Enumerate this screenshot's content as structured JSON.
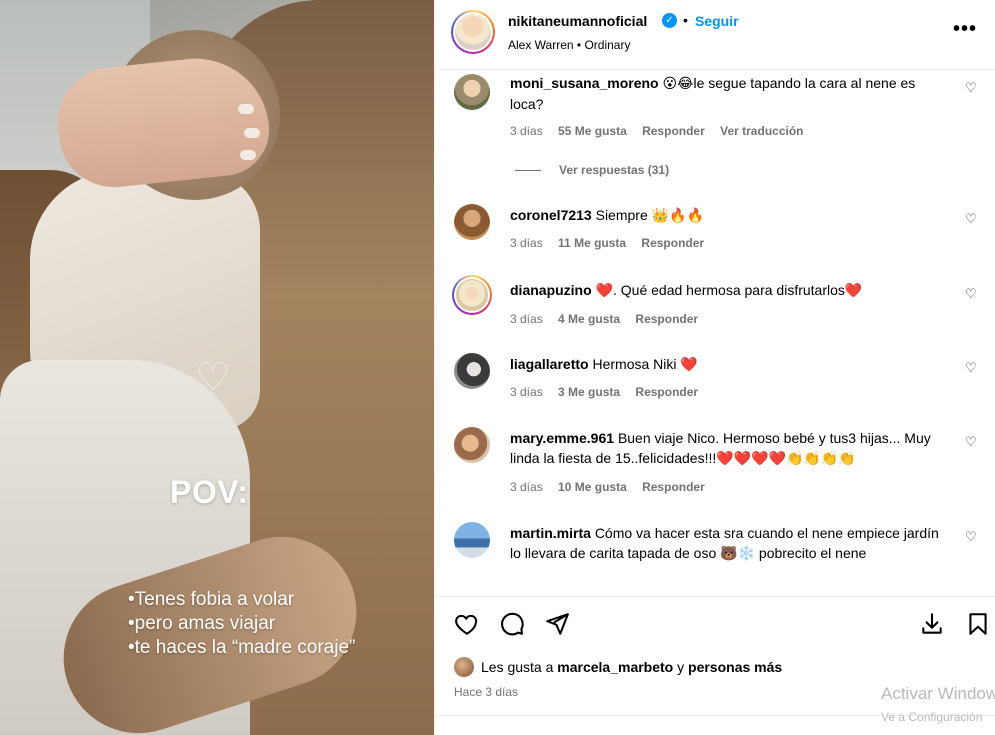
{
  "media": {
    "pov_title": "POV:",
    "pov_lines": [
      "•Tenes fobia a volar",
      "•pero amas viajar",
      "•te haces la “madre coraje”"
    ]
  },
  "header": {
    "username": "nikitaneumannoficial",
    "verified_icon": "verified-badge-icon",
    "separator": "•",
    "follow_label": "Seguir",
    "audio": "Alex Warren • Ordinary",
    "more_label": "•••"
  },
  "comments": [
    {
      "username": "moni_susana_moreno",
      "text_prefix": "😮😂",
      "text": "le segue tapando la cara al nene es loca?",
      "time": "3 días",
      "likes": "55 Me gusta",
      "reply": "Responder",
      "translate": "Ver traducción",
      "view_replies": "Ver respuestas (31)"
    },
    {
      "username": "coronel7213",
      "text": "Siempre",
      "emoji": "👑🔥🔥",
      "time": "3 días",
      "likes": "11 Me gusta",
      "reply": "Responder"
    },
    {
      "username": "dianapuzino",
      "emoji_before": "❤️",
      "text": ". Qué edad hermosa para disfrutarlos",
      "emoji": "❤️",
      "time": "3 días",
      "likes": "4 Me gusta",
      "reply": "Responder"
    },
    {
      "username": "liagallaretto",
      "text": "Hermosa Niki",
      "emoji": "❤️",
      "time": "3 días",
      "likes": "3 Me gusta",
      "reply": "Responder"
    },
    {
      "username": "mary.emme.961",
      "text": "Buen viaje Nico. Hermoso bebé y tus3 hijas... Muy linda la fiesta de 15..felicidades!!!",
      "emoji": "❤️❤️❤️❤️👏👏👏👏",
      "time": "3 días",
      "likes": "10 Me gusta",
      "reply": "Responder"
    },
    {
      "username": "martin.mirta",
      "text": "Cómo va hacer esta sra cuando el nene empiece jardín lo llevara de carita tapada de oso",
      "emoji": "🐻❄️",
      "text_after": "pobrecito el nene"
    }
  ],
  "actions": {
    "like_icon": "heart-outline-icon",
    "comment_icon": "comment-bubble-icon",
    "share_icon": "send-paper-plane-icon",
    "download_icon": "download-icon",
    "save_icon": "bookmark-icon",
    "likes_prefix": "Les gusta a",
    "likes_user": "marcela_marbeto",
    "likes_joiner": "y",
    "likes_suffix": "personas más",
    "posted_ago": "Hace 3 días"
  },
  "watermark": {
    "line1": "Activar Windows",
    "line2": "Ve a Configuración"
  },
  "colors": {
    "accent": "#0095f6",
    "muted": "#737373",
    "heart": "#e0245e"
  }
}
